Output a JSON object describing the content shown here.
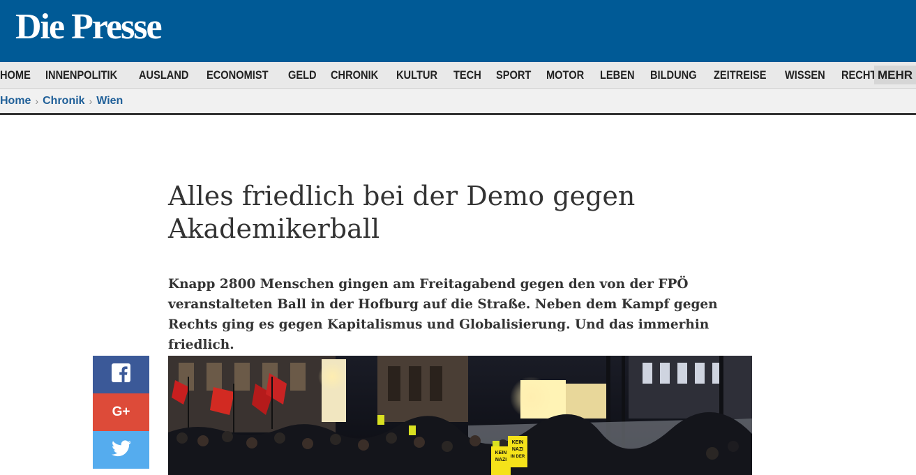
{
  "header": {
    "logo": "Die Presse",
    "brand_color": "#005a96"
  },
  "nav": {
    "items": [
      {
        "label": "HOME"
      },
      {
        "label": "INNENPOLITIK"
      },
      {
        "label": "AUSLAND"
      },
      {
        "label": "ECONOMIST"
      },
      {
        "label": "GELD"
      },
      {
        "label": "CHRONIK"
      },
      {
        "label": "KULTUR"
      },
      {
        "label": "TECH"
      },
      {
        "label": "SPORT"
      },
      {
        "label": "MOTOR"
      },
      {
        "label": "LEBEN"
      },
      {
        "label": "BILDUNG"
      },
      {
        "label": "ZEITREISE"
      },
      {
        "label": "WISSEN"
      },
      {
        "label": "RECHT"
      }
    ],
    "more_label": "MEHR"
  },
  "breadcrumb": {
    "items": [
      {
        "label": "Home"
      },
      {
        "label": "Chronik"
      },
      {
        "label": "Wien"
      }
    ],
    "separator": "›"
  },
  "article": {
    "headline": "Alles friedlich bei der Demo gegen Akademikerball",
    "lead": "Knapp 2800 Menschen gingen am Freitagabend gegen den von der FPÖ veranstalteten Ball in der Hofburg auf die Straße. Neben dem Kampf gegen Rechts ging es gegen Kapitalismus und Globalisierung. Und das immerhin friedlich.",
    "image": {
      "sign_text": [
        "KEIN",
        "NAZI",
        "IN DER"
      ]
    }
  },
  "share": {
    "buttons": [
      {
        "icon": "facebook-icon",
        "color": "#3b5998"
      },
      {
        "icon": "google-plus-icon",
        "label": "G+",
        "color": "#dd4b39"
      },
      {
        "icon": "twitter-icon",
        "color": "#55acee"
      }
    ]
  }
}
